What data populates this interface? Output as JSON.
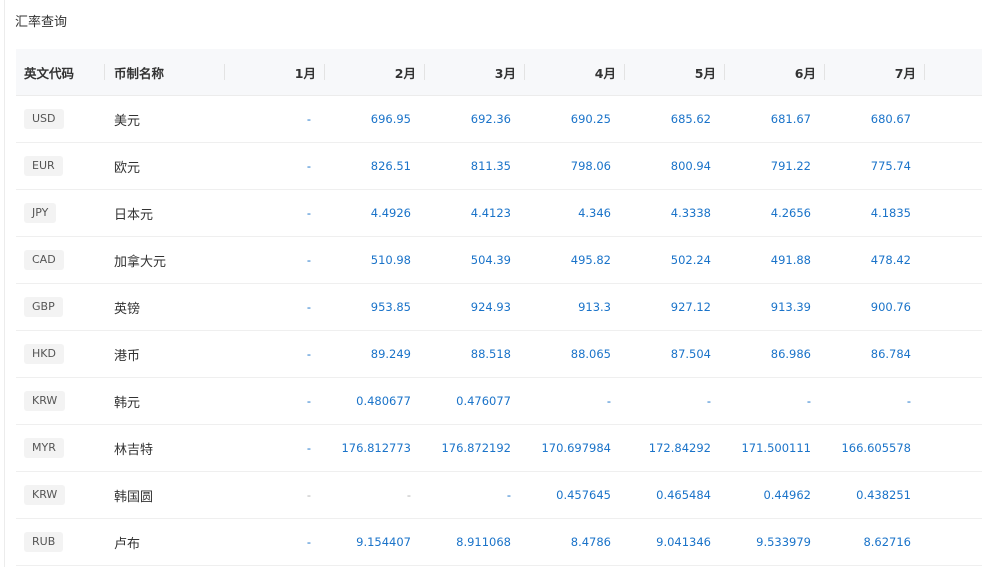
{
  "page_title": "汇率查询",
  "table": {
    "headers": [
      "英文代码",
      "币制名称",
      "1月",
      "2月",
      "3月",
      "4月",
      "5月",
      "6月",
      "7月"
    ],
    "rows": [
      {
        "code": "USD",
        "name": "美元",
        "m": [
          "-",
          "696.95",
          "692.36",
          "690.25",
          "685.62",
          "681.67",
          "680.67"
        ]
      },
      {
        "code": "EUR",
        "name": "欧元",
        "m": [
          "-",
          "826.51",
          "811.35",
          "798.06",
          "800.94",
          "791.22",
          "775.74"
        ]
      },
      {
        "code": "JPY",
        "name": "日本元",
        "m": [
          "-",
          "4.4926",
          "4.4123",
          "4.346",
          "4.3338",
          "4.2656",
          "4.1835"
        ]
      },
      {
        "code": "CAD",
        "name": "加拿大元",
        "m": [
          "-",
          "510.98",
          "504.39",
          "495.82",
          "502.24",
          "491.88",
          "478.42"
        ]
      },
      {
        "code": "GBP",
        "name": "英镑",
        "m": [
          "-",
          "953.85",
          "924.93",
          "913.3",
          "927.12",
          "913.39",
          "900.76"
        ]
      },
      {
        "code": "HKD",
        "name": "港币",
        "m": [
          "-",
          "89.249",
          "88.518",
          "88.065",
          "87.504",
          "86.986",
          "86.784"
        ]
      },
      {
        "code": "KRW",
        "name": "韩元",
        "m": [
          "-",
          "0.480677",
          "0.476077",
          "-",
          "-",
          "-",
          "-"
        ]
      },
      {
        "code": "MYR",
        "name": "林吉特",
        "m": [
          "-",
          "176.812773",
          "176.872192",
          "170.697984",
          "172.84292",
          "171.500111",
          "166.605578"
        ]
      },
      {
        "code": "KRW",
        "name": "韩国圆",
        "m": [
          "-",
          "-",
          "-",
          "0.457645",
          "0.465484",
          "0.44962",
          "0.438251"
        ]
      },
      {
        "code": "RUB",
        "name": "卢布",
        "m": [
          "-",
          "9.154407",
          "8.911068",
          "8.4786",
          "9.041346",
          "9.533979",
          "8.62716"
        ]
      }
    ]
  },
  "colors": {
    "value": "#1a73c9",
    "placeholder_gray": "#b5b5b5",
    "header_bg": "#f7f8fa"
  }
}
